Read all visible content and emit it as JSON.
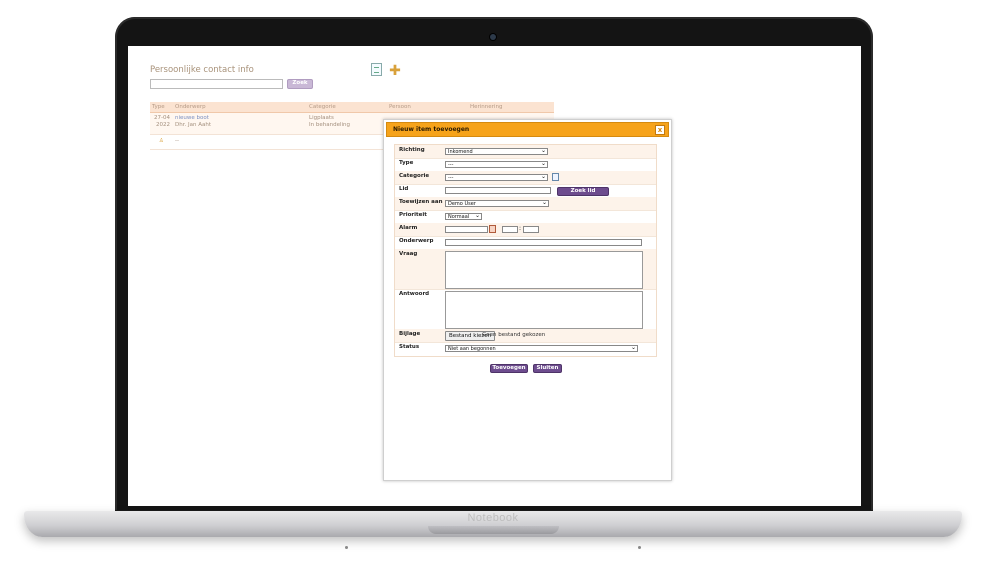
{
  "device": {
    "brand": "Notebook"
  },
  "page": {
    "title": "Persoonlijke contact info",
    "search_button": "Zoek",
    "table": {
      "headers": [
        "Type",
        "Onderwerp",
        "Categorie",
        "Persoon",
        "Herinnering"
      ],
      "rows": [
        {
          "date_line1": "27-04",
          "date_line2": "2022",
          "subject": "nieuwe boot",
          "person": "Dhr. Jan Aaht",
          "category": "Ligplaats",
          "status": "In behandeling"
        },
        {
          "date_line1": "",
          "date_line2": "",
          "subject": "--",
          "person": "",
          "category": "",
          "status": ""
        }
      ]
    }
  },
  "modal": {
    "title": "Nieuw item toevoegen",
    "close_glyph": "x",
    "fields": {
      "richting": {
        "label": "Richting",
        "value": "Inkomend"
      },
      "type": {
        "label": "Type",
        "value": "---"
      },
      "categorie": {
        "label": "Categorie",
        "value": "---"
      },
      "lid": {
        "label": "Lid",
        "value": "",
        "button": "Zoek lid"
      },
      "toewijzen": {
        "label": "Toewijzen aan",
        "value": "Demo User"
      },
      "prioriteit": {
        "label": "Prioriteit",
        "value": "Normaal"
      },
      "alarm": {
        "label": "Alarm",
        "sep": ":"
      },
      "onderwerp": {
        "label": "Onderwerp"
      },
      "vraag": {
        "label": "Vraag"
      },
      "antwoord": {
        "label": "Antwoord"
      },
      "bijlage": {
        "label": "Bijlage",
        "button": "Bestand kiezen",
        "status": "Geen bestand gekozen"
      },
      "status": {
        "label": "Status",
        "value": "Niet aan begonnen"
      }
    },
    "buttons": {
      "add": "Toevoegen",
      "close": "Sluiten"
    }
  },
  "colors": {
    "accent": "#f6a31b",
    "button": "#6d4c8e",
    "header_row": "#fbe3d1"
  }
}
